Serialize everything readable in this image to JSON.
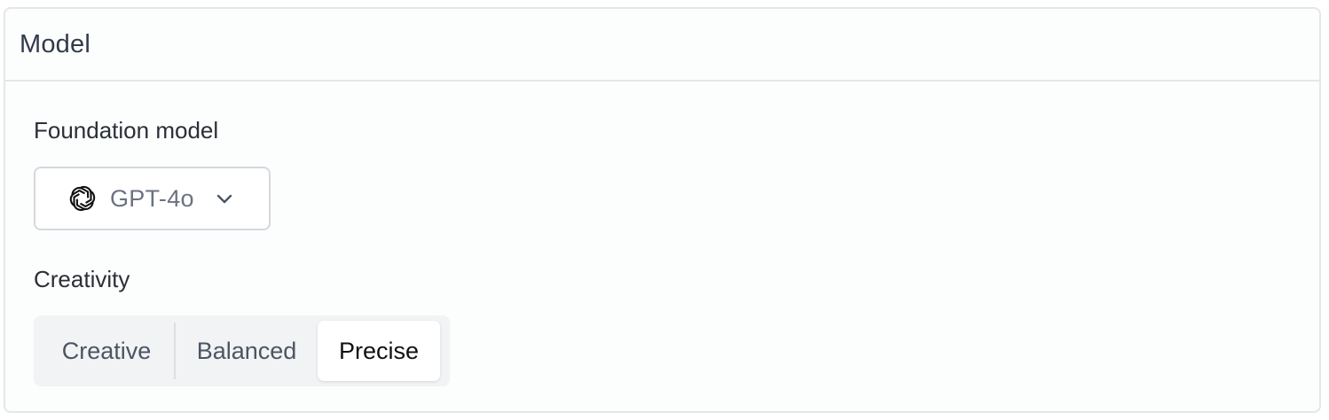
{
  "panel": {
    "title": "Model"
  },
  "foundation_model": {
    "label": "Foundation model",
    "selected": "GPT-4o",
    "icon": "openai-logo-icon",
    "dropdown_icon": "chevron-down-icon"
  },
  "creativity": {
    "label": "Creativity",
    "options": [
      "Creative",
      "Balanced",
      "Precise"
    ],
    "selected": "Precise"
  }
}
